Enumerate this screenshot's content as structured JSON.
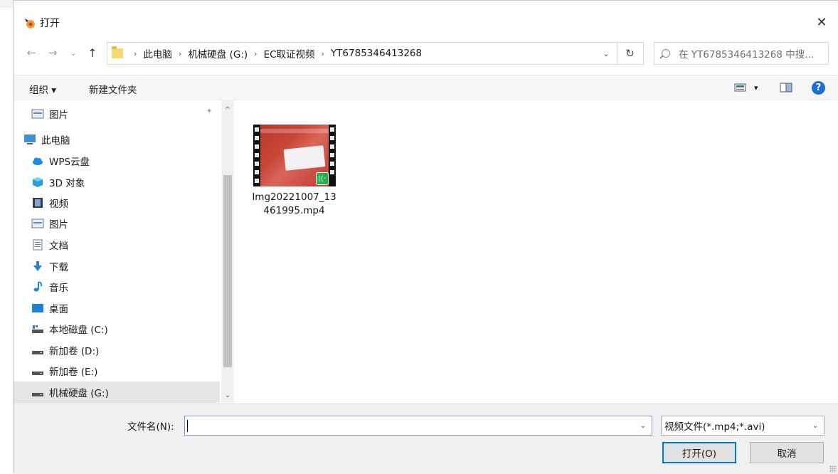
{
  "window": {
    "title": "打开",
    "close_glyph": "✕"
  },
  "nav": {
    "back_glyph": "←",
    "forward_glyph": "→",
    "recent_glyph": "⌄",
    "up_glyph": "↑",
    "breadcrumbs": [
      "此电脑",
      "机械硬盘 (G:)",
      "EC取证视频",
      "YT6785346413268"
    ],
    "separator": "›",
    "dropdown_glyph": "⌄",
    "refresh_glyph": "↻",
    "search_placeholder": "在 YT6785346413268 中搜..."
  },
  "toolbar": {
    "organize_label": "组织 ▾",
    "new_folder_label": "新建文件夹",
    "view_dd_glyph": "▾",
    "help_glyph": "?"
  },
  "sidebar": {
    "items": [
      {
        "label": "图片",
        "icon": "pictures-icon",
        "pinned": true
      },
      {
        "label": "此电脑",
        "icon": "computer-icon"
      },
      {
        "label": "WPS云盘",
        "icon": "cloud-icon"
      },
      {
        "label": "3D 对象",
        "icon": "cube-icon"
      },
      {
        "label": "视频",
        "icon": "video-icon"
      },
      {
        "label": "图片",
        "icon": "pictures-icon"
      },
      {
        "label": "文档",
        "icon": "document-icon"
      },
      {
        "label": "下载",
        "icon": "download-icon"
      },
      {
        "label": "音乐",
        "icon": "music-icon"
      },
      {
        "label": "桌面",
        "icon": "desktop-icon"
      },
      {
        "label": "本地磁盘 (C:)",
        "icon": "system-drive-icon"
      },
      {
        "label": "新加卷 (D:)",
        "icon": "drive-icon"
      },
      {
        "label": "新加卷 (E:)",
        "icon": "drive-icon"
      },
      {
        "label": "机械硬盘 (G:)",
        "icon": "drive-icon",
        "selected": true
      }
    ],
    "pin_glyph": "📌",
    "scroll_up_glyph": "^",
    "scroll_down_glyph": "⌄"
  },
  "content": {
    "files": [
      {
        "name": "Img20221007_13461995.mp4",
        "type": "video"
      }
    ]
  },
  "footer": {
    "filename_label": "文件名(N):",
    "filename_value": "",
    "filetype_value": "视频文件(*.mp4;*.avi)",
    "open_label": "打开(O)",
    "cancel_label": "取消",
    "dd_glyph": "⌄"
  },
  "colors": {
    "accent": "#0078d7",
    "help": "#1a6fd1",
    "folder": "#f8d775",
    "badge": "#22b14c"
  }
}
